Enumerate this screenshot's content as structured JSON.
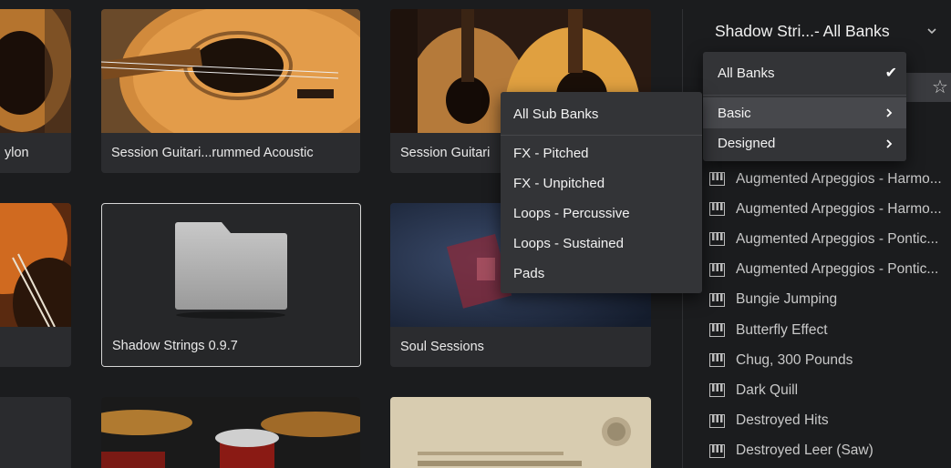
{
  "grid": {
    "tiles": [
      {
        "caption": "ylon"
      },
      {
        "caption": "Session Guitari...rummed Acoustic"
      },
      {
        "caption": "Session Guitari"
      },
      {
        "caption": ""
      },
      {
        "caption": "Shadow Strings 0.9.7"
      },
      {
        "caption": "Soul Sessions"
      },
      {
        "caption": ""
      },
      {
        "caption": ""
      },
      {
        "caption": ""
      }
    ]
  },
  "browser": {
    "bank_title": "Shadow Stri...- All Banks",
    "bank_menu": {
      "items": [
        {
          "label": "All Banks",
          "checked": true
        },
        {
          "label": "Basic",
          "has_submenu": true,
          "highlighted": true
        },
        {
          "label": "Designed",
          "has_submenu": true
        }
      ]
    },
    "sub_menu": {
      "items": [
        {
          "label": "All Sub Banks"
        },
        {
          "label": "FX - Pitched"
        },
        {
          "label": "FX - Unpitched"
        },
        {
          "label": "Loops - Percussive"
        },
        {
          "label": "Loops - Sustained"
        },
        {
          "label": "Pads"
        }
      ]
    },
    "presets": [
      "Augmented Arpeggios - Harmo...",
      "Augmented Arpeggios - Harmo...",
      "Augmented Arpeggios - Pontic...",
      "Augmented Arpeggios - Pontic...",
      "Bungie Jumping",
      "Butterfly Effect",
      "Chug, 300 Pounds",
      "Dark Quill",
      "Destroyed Hits",
      "Destroyed Leer (Saw)"
    ],
    "icons": {
      "star": "star-icon",
      "preset": "piano-keys-icon",
      "chevron": "chevron-down-icon"
    }
  }
}
